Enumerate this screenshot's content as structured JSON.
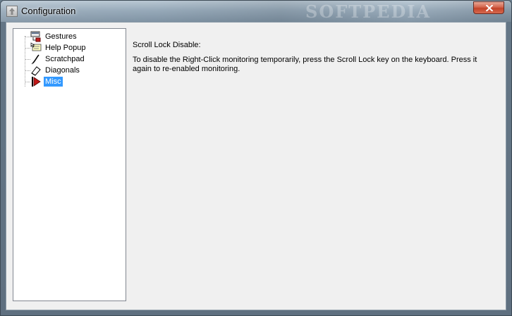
{
  "window": {
    "title": "Configuration",
    "watermark": "SOFTPEDIA"
  },
  "tree": {
    "items": [
      {
        "label": "Gestures",
        "icon": "gestures-icon",
        "selected": false
      },
      {
        "label": "Help Popup",
        "icon": "help-popup-icon",
        "selected": false
      },
      {
        "label": "Scratchpad",
        "icon": "scratchpad-icon",
        "selected": false
      },
      {
        "label": "Diagonals",
        "icon": "diagonals-icon",
        "selected": false
      },
      {
        "label": "Misc",
        "icon": "misc-icon",
        "selected": true
      }
    ]
  },
  "content": {
    "heading": "Scroll Lock Disable:",
    "body": "To disable the Right-Click monitoring temporarily, press the Scroll Lock key on the keyboard. Press it again to  re-enabled monitoring."
  },
  "colors": {
    "selection": "#3399ff",
    "client_background": "#f0f0f0",
    "close_button": "#c94b32"
  }
}
